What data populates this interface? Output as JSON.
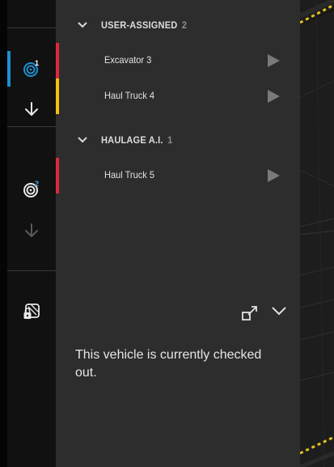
{
  "rail": {
    "buttons": [
      {
        "id": "target-1",
        "icon": "target-icon",
        "badge": "1",
        "active": true
      },
      {
        "id": "download-1",
        "icon": "arrow-down-icon",
        "active": false
      },
      {
        "id": "target-2",
        "icon": "target-icon",
        "badge": "2",
        "active": false
      },
      {
        "id": "download-2",
        "icon": "arrow-down-icon",
        "active": false,
        "disabled": true
      },
      {
        "id": "locked-layers",
        "icon": "lock-layers-icon",
        "active": false
      }
    ]
  },
  "groups": [
    {
      "title": "USER-ASSIGNED",
      "count": "2",
      "vehicles": [
        {
          "name": "Excavator 3",
          "status_color": "#e0283a"
        },
        {
          "name": "Haul Truck 4",
          "status_color": "#f4c20d"
        }
      ]
    },
    {
      "title": "HAULAGE A.I.",
      "count": "1",
      "vehicles": [
        {
          "name": "Haul Truck 5",
          "status_color": "#e0283a"
        }
      ]
    }
  ],
  "panel": {
    "info_text": "This vehicle is currently checked out."
  },
  "colors": {
    "accent": "#1e8fd0",
    "panel_bg": "#2d2d2d",
    "rail_bg": "#111111",
    "map_hazard": "#e5c21b"
  }
}
